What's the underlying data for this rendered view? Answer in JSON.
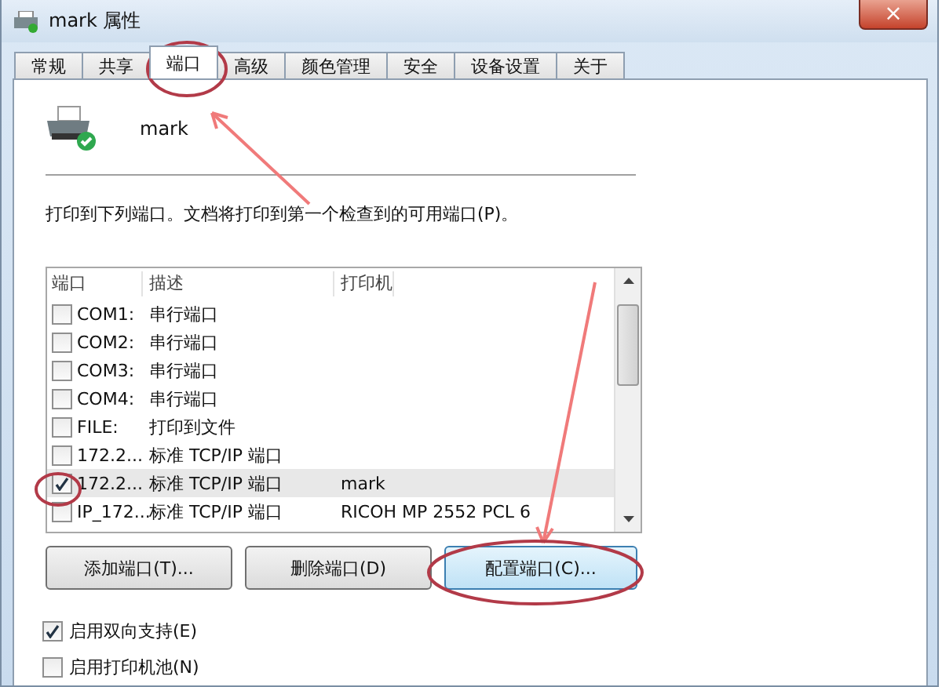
{
  "window": {
    "title": "mark 属性",
    "close": "×"
  },
  "tabs": [
    {
      "label": "常规",
      "selected": false
    },
    {
      "label": "共享",
      "selected": false
    },
    {
      "label": "端口",
      "selected": true
    },
    {
      "label": "高级",
      "selected": false
    },
    {
      "label": "颜色管理",
      "selected": false
    },
    {
      "label": "安全",
      "selected": false
    },
    {
      "label": "设备设置",
      "selected": false
    },
    {
      "label": "关于",
      "selected": false
    }
  ],
  "printer": {
    "name": "mark"
  },
  "instruction": "打印到下列端口。文档将打印到第一个检查到的可用端口(P)。",
  "port_list": {
    "columns": [
      "端口",
      "描述",
      "打印机"
    ],
    "rows": [
      {
        "port": "COM1:",
        "description": "串行端口",
        "printer": "",
        "checked": false,
        "selected": false
      },
      {
        "port": "COM2:",
        "description": "串行端口",
        "printer": "",
        "checked": false,
        "selected": false
      },
      {
        "port": "COM3:",
        "description": "串行端口",
        "printer": "",
        "checked": false,
        "selected": false
      },
      {
        "port": "COM4:",
        "description": "串行端口",
        "printer": "",
        "checked": false,
        "selected": false
      },
      {
        "port": "FILE:",
        "description": "打印到文件",
        "printer": "",
        "checked": false,
        "selected": false
      },
      {
        "port": "172.2...",
        "description": "标准 TCP/IP 端口",
        "printer": "",
        "checked": false,
        "selected": false
      },
      {
        "port": "172.2...",
        "description": "标准 TCP/IP 端口",
        "printer": "mark",
        "checked": true,
        "selected": true
      },
      {
        "port": "IP_172...",
        "description": "标准 TCP/IP 端口",
        "printer": "RICOH MP 2552 PCL 6",
        "checked": false,
        "selected": false
      }
    ]
  },
  "buttons": [
    {
      "label": "添加端口(T)...",
      "selected": false
    },
    {
      "label": "删除端口(D)",
      "selected": false
    },
    {
      "label": "配置端口(C)...",
      "selected": true
    }
  ],
  "options": [
    {
      "label": "启用双向支持(E)",
      "checked": true
    },
    {
      "label": "启用打印机池(N)",
      "checked": false
    }
  ]
}
